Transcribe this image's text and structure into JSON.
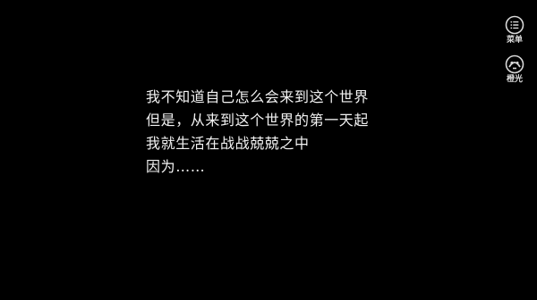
{
  "story": {
    "lines": [
      "我不知道自己怎么会来到这个世界",
      "但是，从来到这个世界的第一天起",
      "我就生活在战战兢兢之中",
      "因为……"
    ]
  },
  "side_buttons": {
    "menu": {
      "label": "菜单",
      "icon": "list-menu-icon"
    },
    "light": {
      "label": "橙光",
      "icon": "orange-light-logo-icon"
    }
  },
  "colors": {
    "background": "#000000",
    "text": "#f2f2f2",
    "button_label": "#d8d8d8"
  }
}
